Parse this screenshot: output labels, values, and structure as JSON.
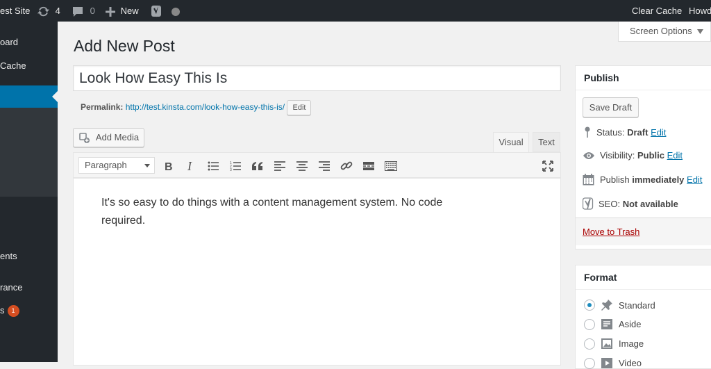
{
  "adminbar": {
    "site_name": "est Site",
    "updates_count": "4",
    "comments_count": "0",
    "new_label": "New",
    "clear_cache": "Clear Cache",
    "howdy": "Howd"
  },
  "sidebar": {
    "items": [
      {
        "label": "oard"
      },
      {
        "label": "Cache"
      },
      {
        "label": "ents"
      },
      {
        "label": "rance"
      },
      {
        "label": "s"
      }
    ],
    "plugins_badge": "1"
  },
  "screen_options": "Screen Options",
  "page_title": "Add New Post",
  "post": {
    "title": "Look How Easy This Is",
    "permalink_label": "Permalink:",
    "permalink_base": "http://test.kinsta.com/",
    "permalink_slug": "look-how-easy-this-is",
    "permalink_trailing": "/",
    "permalink_edit": "Edit",
    "content": "It's so easy to do things with a content management system. No code required."
  },
  "editor": {
    "add_media": "Add Media",
    "tab_visual": "Visual",
    "tab_text": "Text",
    "format_selected": "Paragraph"
  },
  "publish": {
    "heading": "Publish",
    "save_draft": "Save Draft",
    "status_label": "Status:",
    "status_value": "Draft",
    "visibility_label": "Visibility:",
    "visibility_value": "Public",
    "publish_label": "Publish",
    "publish_value": "immediately",
    "edit": "Edit",
    "seo_label": "SEO:",
    "seo_value": "Not available",
    "trash": "Move to Trash"
  },
  "format": {
    "heading": "Format",
    "options": [
      {
        "label": "Standard",
        "selected": true
      },
      {
        "label": "Aside",
        "selected": false
      },
      {
        "label": "Image",
        "selected": false
      },
      {
        "label": "Video",
        "selected": false
      }
    ]
  },
  "colors": {
    "adminbar": "#23282d",
    "accent": "#0073aa",
    "badge": "#d54e21",
    "trash": "#a00"
  }
}
